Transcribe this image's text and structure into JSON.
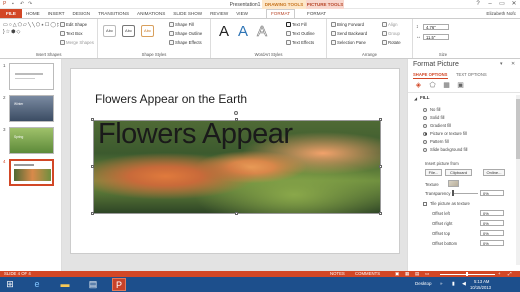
{
  "window": {
    "title": "Presentation1 - PowerPoint",
    "contextual_drawing": "DRAWING TOOLS",
    "contextual_picture": "PICTURE TOOLS",
    "user": "Elizabeth Nofc"
  },
  "tabs": [
    "FILE",
    "HOME",
    "INSERT",
    "DESIGN",
    "TRANSITIONS",
    "ANIMATIONS",
    "SLIDE SHOW",
    "REVIEW",
    "VIEW",
    "FORMAT",
    "FORMAT"
  ],
  "ribbon": {
    "insert_shapes": {
      "label": "Insert Shapes",
      "edit_shape": "Edit Shape",
      "text_box": "Text Box",
      "merge_shapes": "Merge Shapes"
    },
    "shape_styles": {
      "label": "Shape Styles",
      "abc": "Abc",
      "fill": "Shape Fill",
      "outline": "Shape Outline",
      "effects": "Shape Effects"
    },
    "wordart": {
      "label": "WordArt Styles",
      "a": "A",
      "text_fill": "Text Fill",
      "text_outline": "Text Outline",
      "text_effects": "Text Effects"
    },
    "arrange": {
      "label": "Arrange",
      "bring_forward": "Bring Forward",
      "send_backward": "Send Backward",
      "selection_pane": "Selection Pane",
      "align": "Align",
      "group": "Group",
      "rotate": "Rotate"
    },
    "size": {
      "label": "Size",
      "height": "4.76\"",
      "width": "11.5\""
    }
  },
  "slides": [
    {
      "num": "1"
    },
    {
      "num": "2",
      "text": "Winter"
    },
    {
      "num": "3",
      "text": "Spring"
    },
    {
      "num": "4"
    }
  ],
  "slide": {
    "title": "Flowers Appear on the Earth",
    "picture_text": "Flowers Appear"
  },
  "pane": {
    "title": "Format Picture",
    "tab_shape": "SHAPE OPTIONS",
    "tab_text": "TEXT OPTIONS",
    "section_fill": "FILL",
    "fill_options": [
      "No fill",
      "Solid fill",
      "Gradient fill",
      "Picture or texture fill",
      "Pattern fill",
      "Slide background fill"
    ],
    "selected_fill": 3,
    "insert_from": "Insert picture from",
    "btn_file": "File...",
    "btn_clipboard": "Clipboard",
    "btn_online": "Online...",
    "texture": "Texture",
    "transparency": "Transparency",
    "transparency_val": "0%",
    "tile": "Tile picture as texture",
    "offsets": [
      {
        "label": "Offset left",
        "value": "0%"
      },
      {
        "label": "Offset right",
        "value": "0%"
      },
      {
        "label": "Offset top",
        "value": "0%"
      },
      {
        "label": "Offset bottom",
        "value": "0%"
      }
    ]
  },
  "status": {
    "slide_of": "SLIDE 4 OF 4",
    "notes": "NOTES",
    "comments": "COMMENTS",
    "zoom": "+"
  },
  "taskbar": {
    "desktop": "Desktop",
    "time": "5:13 AM",
    "date": "10/15/2013"
  },
  "colors": {
    "accent": "#d24726",
    "taskbar": "#1d4f8c"
  }
}
